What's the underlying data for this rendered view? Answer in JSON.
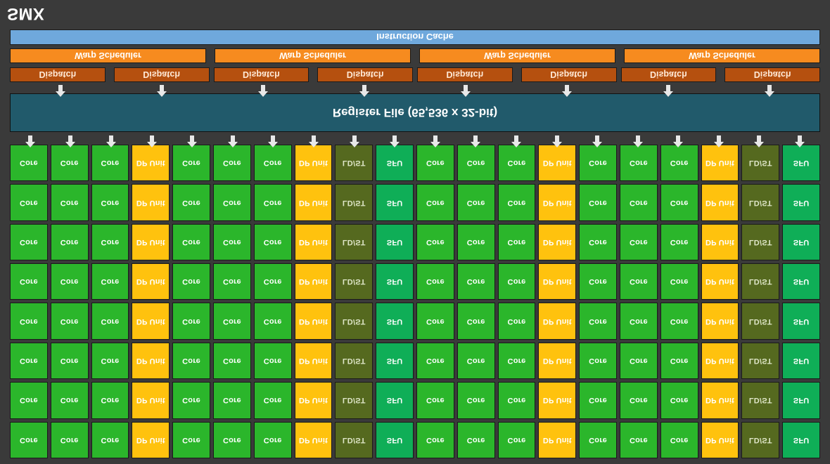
{
  "diagram": {
    "title": "SMX",
    "orientation": "vertically-flipped",
    "background_color": "#3a3a3a"
  },
  "instruction_cache": {
    "label": "Instruction Cache",
    "color": "#6fa8dc"
  },
  "warp_schedulers": {
    "label": "Warp Scheduler",
    "count": 4,
    "color": "#f68b1f",
    "items": [
      {
        "label": "Warp Scheduler"
      },
      {
        "label": "Warp Scheduler"
      },
      {
        "label": "Warp Scheduler"
      },
      {
        "label": "Warp Scheduler"
      }
    ]
  },
  "dispatch_units": {
    "label": "Dispatch",
    "count": 8,
    "color": "#b5500f",
    "items": [
      {
        "label": "Dispatch"
      },
      {
        "label": "Dispatch"
      },
      {
        "label": "Dispatch"
      },
      {
        "label": "Dispatch"
      },
      {
        "label": "Dispatch"
      },
      {
        "label": "Dispatch"
      },
      {
        "label": "Dispatch"
      },
      {
        "label": "Dispatch"
      }
    ]
  },
  "register_file": {
    "label": "Register File (65,536 x 32-bit)",
    "color": "#215a6b",
    "entries": 65536,
    "width_bits": 32
  },
  "execution_grid": {
    "rows": 8,
    "columns": 20,
    "unit_types": {
      "core": {
        "label": "Core",
        "color": "#2bb62b"
      },
      "dp": {
        "label": "DP Unit",
        "color": "#ffc20e"
      },
      "ldst": {
        "label": "LD/ST",
        "color": "#55691f"
      },
      "sfu": {
        "label": "SFU",
        "color": "#0fae57"
      }
    },
    "column_pattern": [
      "core",
      "core",
      "core",
      "dp",
      "core",
      "core",
      "core",
      "dp",
      "ldst",
      "sfu",
      "core",
      "core",
      "core",
      "dp",
      "core",
      "core",
      "core",
      "dp",
      "ldst",
      "sfu"
    ],
    "row_labels": [
      [
        "Core",
        "Core",
        "Core",
        "DP Unit",
        "Core",
        "Core",
        "Core",
        "DP Unit",
        "LD/ST",
        "SFU",
        "Core",
        "Core",
        "Core",
        "DP Unit",
        "Core",
        "Core",
        "Core",
        "DP Unit",
        "LD/ST",
        "SFU"
      ],
      [
        "Core",
        "Core",
        "Core",
        "DP Unit",
        "Core",
        "Core",
        "Core",
        "DP Unit",
        "LD/ST",
        "SFU",
        "Core",
        "Core",
        "Core",
        "DP Unit",
        "Core",
        "Core",
        "Core",
        "DP Unit",
        "LD/ST",
        "SFU"
      ],
      [
        "Core",
        "Core",
        "Core",
        "DP Unit",
        "Core",
        "Core",
        "Core",
        "DP Unit",
        "LD/ST",
        "SFU",
        "Core",
        "Core",
        "Core",
        "DP Unit",
        "Core",
        "Core",
        "Core",
        "DP Unit",
        "LD/ST",
        "SFU"
      ],
      [
        "Core",
        "Core",
        "Core",
        "DP Unit",
        "Core",
        "Core",
        "Core",
        "DP Unit",
        "LD/ST",
        "SFU",
        "Core",
        "Core",
        "Core",
        "DP Unit",
        "Core",
        "Core",
        "Core",
        "DP Unit",
        "LD/ST",
        "SFU"
      ],
      [
        "Core",
        "Core",
        "Core",
        "DP Unit",
        "Core",
        "Core",
        "Core",
        "DP Unit",
        "LD/ST",
        "SFU",
        "Core",
        "Core",
        "Core",
        "DP Unit",
        "Core",
        "Core",
        "Core",
        "DP Unit",
        "LD/ST",
        "SFU"
      ],
      [
        "Core",
        "Core",
        "Core",
        "DP Unit",
        "Core",
        "Core",
        "Core",
        "DP Unit",
        "LD/ST",
        "SFU",
        "Core",
        "Core",
        "Core",
        "DP Unit",
        "Core",
        "Core",
        "Core",
        "DP Unit",
        "LD/ST",
        "SFU"
      ],
      [
        "Core",
        "Core",
        "Core",
        "DP Unit",
        "Core",
        "Core",
        "Core",
        "DP Unit",
        "LD/ST",
        "SFU",
        "Core",
        "Core",
        "Core",
        "DP Unit",
        "Core",
        "Core",
        "Core",
        "DP Unit",
        "LD/ST",
        "SFU"
      ],
      [
        "Core",
        "Core",
        "Core",
        "DP Unit",
        "Core",
        "Core",
        "Core",
        "DP Unit",
        "LD/ST",
        "SFU",
        "Core",
        "Core",
        "Core",
        "DP Unit",
        "Core",
        "Core",
        "Core",
        "DP Unit",
        "LD/ST",
        "SFU"
      ]
    ]
  },
  "arrows": {
    "register_to_grid_count": 20,
    "warp_to_dispatch_count": 8,
    "glyph": "arrow-up-icon"
  }
}
